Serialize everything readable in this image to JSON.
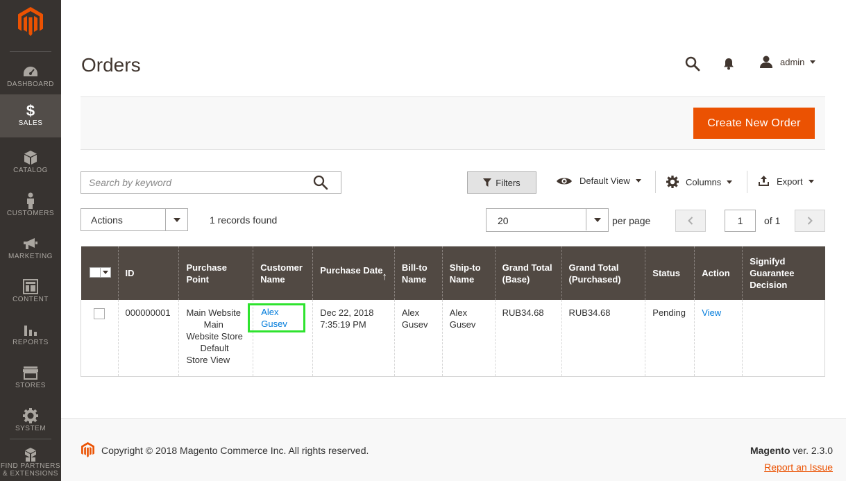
{
  "sidebar": {
    "items": [
      {
        "label": "DASHBOARD",
        "icon": "dashboard-icon"
      },
      {
        "label": "SALES",
        "icon": "dollar-icon",
        "active": true
      },
      {
        "label": "CATALOG",
        "icon": "box-icon"
      },
      {
        "label": "CUSTOMERS",
        "icon": "person-icon"
      },
      {
        "label": "MARKETING",
        "icon": "megaphone-icon"
      },
      {
        "label": "CONTENT",
        "icon": "layout-icon"
      },
      {
        "label": "REPORTS",
        "icon": "bar-chart-icon"
      },
      {
        "label": "STORES",
        "icon": "storefront-icon"
      },
      {
        "label": "SYSTEM",
        "icon": "gear-icon"
      },
      {
        "label": "FIND PARTNERS & EXTENSIONS",
        "icon": "boxes-icon"
      }
    ]
  },
  "header": {
    "title": "Orders",
    "user": "admin"
  },
  "actions_bar": {
    "create_button": "Create New Order"
  },
  "toolbar": {
    "search_placeholder": "Search by keyword",
    "filters_label": "Filters",
    "view_label": "Default View",
    "columns_label": "Columns",
    "export_label": "Export",
    "mass_actions": "Actions",
    "records_found": "1 records found",
    "per_page_value": "20",
    "per_page_label": "per page",
    "page_current": "1",
    "page_total_label": "of 1"
  },
  "grid": {
    "columns": [
      "ID",
      "Purchase Point",
      "Customer Name",
      "Purchase Date",
      "Bill-to Name",
      "Ship-to Name",
      "Grand Total (Base)",
      "Grand Total (Purchased)",
      "Status",
      "Action",
      "Signifyd Guarantee Decision"
    ],
    "rows": [
      {
        "id": "000000001",
        "purchase_point": [
          "Main Website",
          "Main",
          "Website Store",
          "Default",
          "Store View"
        ],
        "customer_name": "Alex Gusev",
        "purchase_date": [
          "Dec 22, 2018",
          "7:35:19 PM"
        ],
        "bill_to": [
          "Alex",
          "Gusev"
        ],
        "ship_to": [
          "Alex",
          "Gusev"
        ],
        "grand_total_base": "RUB34.68",
        "grand_total_purchased": "RUB34.68",
        "status": "Pending",
        "action": "View",
        "signifyd": ""
      }
    ]
  },
  "footer": {
    "copyright": "Copyright © 2018 Magento Commerce Inc. All rights reserved.",
    "product": "Magento",
    "version": " ver. 2.3.0",
    "report_issue": "Report an Issue"
  },
  "colors": {
    "accent": "#eb5202",
    "sidebar_bg": "#373330",
    "grid_header": "#514943",
    "link": "#007bdb",
    "highlight": "#2ee32e"
  }
}
